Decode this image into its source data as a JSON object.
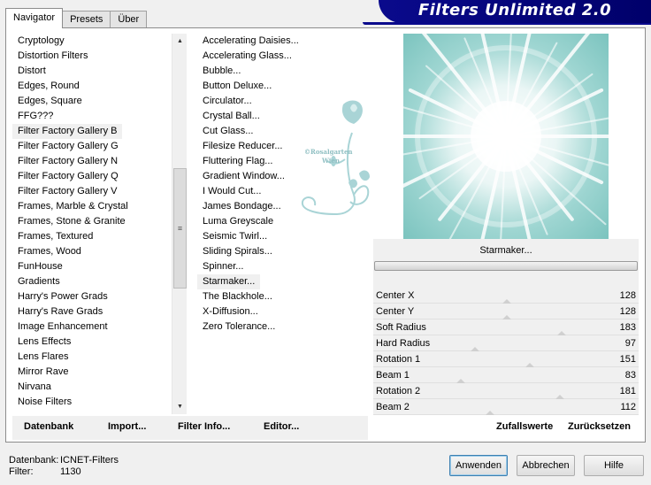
{
  "tabs": [
    "Navigator",
    "Presets",
    "Über"
  ],
  "app_title": "Filters Unlimited 2.0",
  "categories": [
    "Cryptology",
    "Distortion Filters",
    "Distort",
    "Edges, Round",
    "Edges, Square",
    "FFG???",
    "Filter Factory Gallery B",
    "Filter Factory Gallery G",
    "Filter Factory Gallery N",
    "Filter Factory Gallery Q",
    "Filter Factory Gallery V",
    "Frames, Marble & Crystal",
    "Frames, Stone & Granite",
    "Frames, Textured",
    "Frames, Wood",
    "FunHouse",
    "Gradients",
    "Harry's Power Grads",
    "Harry's Rave Grads",
    "Image Enhancement",
    "Lens Effects",
    "Lens Flares",
    "Mirror Rave",
    "Nirvana",
    "Noise Filters"
  ],
  "selected_category_index": 6,
  "filters": [
    "Accelerating Daisies...",
    "Accelerating Glass...",
    "Bubble...",
    "Button Deluxe...",
    "Circulator...",
    "Crystal Ball...",
    "Cut Glass...",
    "Filesize Reducer...",
    "Fluttering Flag...",
    "Gradient Window...",
    "I Would Cut...",
    "James Bondage...",
    "Luma Greyscale",
    "Seismic Twirl...",
    "Sliding Spirals...",
    "Spinner...",
    "Starmaker...",
    "The Blackhole...",
    "X-Diffusion...",
    "Zero Tolerance..."
  ],
  "selected_filter_index": 16,
  "watermark_text": [
    "©Rosalgarten",
    "Wien"
  ],
  "current_filter": "Starmaker...",
  "params": [
    {
      "name": "Center X",
      "value": 128
    },
    {
      "name": "Center Y",
      "value": 128
    },
    {
      "name": "Soft Radius",
      "value": 183
    },
    {
      "name": "Hard Radius",
      "value": 97
    },
    {
      "name": "Rotation 1",
      "value": 151
    },
    {
      "name": "Beam 1",
      "value": 83
    },
    {
      "name": "Rotation 2",
      "value": 181
    },
    {
      "name": "Beam 2",
      "value": 112
    }
  ],
  "toolbar": {
    "datenbank": "Datenbank",
    "import": "Import...",
    "filter_info": "Filter Info...",
    "editor": "Editor...",
    "zufallswerte": "Zufallswerte",
    "zuruecksetzen": "Zurücksetzen"
  },
  "status": {
    "datenbank_label": "Datenbank:",
    "datenbank_value": "ICNET-Filters",
    "filter_label": "Filter:",
    "filter_value": "1130"
  },
  "buttons": {
    "anwenden": "Anwenden",
    "abbrechen": "Abbrechen",
    "hilfe": "Hilfe"
  },
  "colors": {
    "banner": "#0a0a8c",
    "preview_teal": "#8fcfcb",
    "watermark": "#a9d4d6"
  }
}
